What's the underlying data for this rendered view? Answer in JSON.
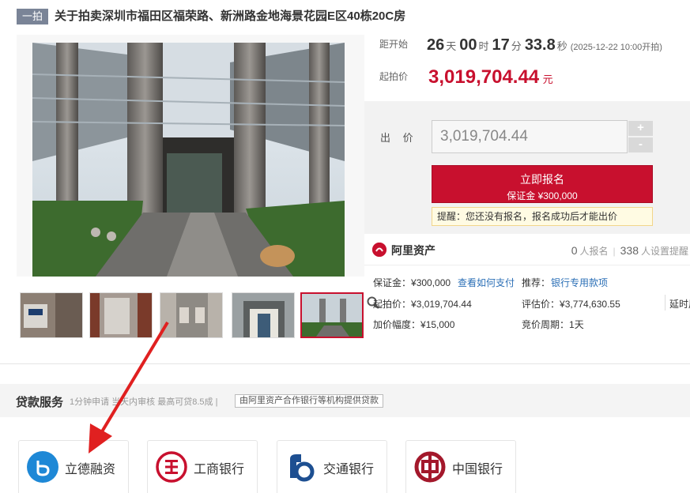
{
  "title": {
    "badge": "一拍",
    "text": "关于拍卖深圳市福田区福荣路、新洲路金地海景花园E区40栋20C房"
  },
  "timer": {
    "label": "距开始",
    "days": "26",
    "days_unit": "天",
    "hours": "00",
    "hours_unit": "时",
    "minutes": "17",
    "minutes_unit": "分",
    "seconds": "33.8",
    "seconds_unit": "秒",
    "start_note": "(2025-12-22 10:00开拍)"
  },
  "start_price": {
    "label": "起拍价",
    "value": "3,019,704.44",
    "unit": "元"
  },
  "bid": {
    "label": "出 价",
    "input_value": "3,019,704.44",
    "plus": "+",
    "minus": "-",
    "signup_label": "立即报名",
    "deposit_note": "保证金 ¥300,000",
    "hint": "提醒：您还没有报名，报名成功后才能出价"
  },
  "platform": {
    "name": "阿里资产",
    "signup_count": "0",
    "signup_label": "人报名",
    "reminder_count": "338",
    "reminder_label": "人设置提醒"
  },
  "details": {
    "deposit_label": "保证金：",
    "deposit_value": "¥300,000",
    "how_to_pay": "查看如何支付",
    "recommend_label": "推荐：",
    "recommend_link": "银行专用款项",
    "start_price_label": "起拍价：",
    "start_price_value": "¥3,019,704.44",
    "appraisal_label": "评估价：",
    "appraisal_value": "¥3,774,630.55",
    "delay_label": "延时周",
    "increment_label": "加价幅度：",
    "increment_value": "¥15,000",
    "cycle_label": "竞价周期：",
    "cycle_value": "1天"
  },
  "loan": {
    "title": "贷款服务",
    "subtitle": "1分钟申请 当天内审核 最高可贷8.5成 |",
    "tag": "由阿里资产合作银行等机构提供贷款",
    "banks": [
      {
        "name": "立德融资"
      },
      {
        "name": "工商银行"
      },
      {
        "name": "交通银行"
      },
      {
        "name": "中国银行"
      }
    ]
  },
  "colors": {
    "accent": "#c8102e",
    "link": "#2b6fb6",
    "badge": "#7a8497"
  }
}
